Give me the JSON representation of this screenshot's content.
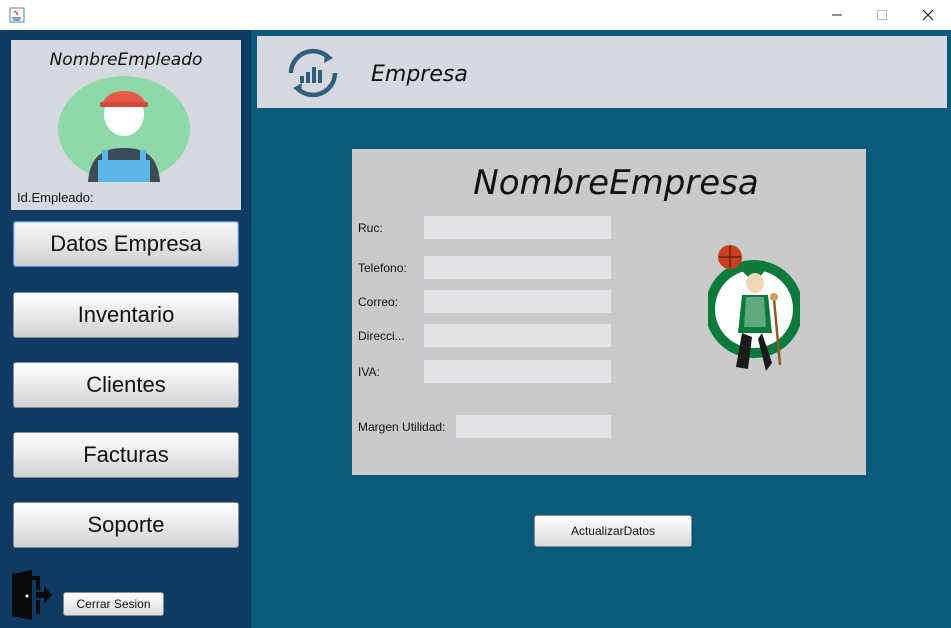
{
  "window": {
    "icon": "java-icon"
  },
  "employee": {
    "name": "NombreEmpleado",
    "id_label": "Id.Empleado:"
  },
  "nav": {
    "items": [
      {
        "label": "Datos Empresa"
      },
      {
        "label": "Inventario"
      },
      {
        "label": "Clientes"
      },
      {
        "label": "Facturas"
      },
      {
        "label": "Soporte"
      }
    ],
    "logout_label": "Cerrar Sesion"
  },
  "header": {
    "title": "Empresa"
  },
  "company": {
    "name": "NombreEmpresa",
    "fields": {
      "ruc": {
        "label": "Ruc:",
        "value": ""
      },
      "telefono": {
        "label": "Telefono:",
        "value": ""
      },
      "correo": {
        "label": "Correo:",
        "value": ""
      },
      "direccion": {
        "label": "Direcci...",
        "value": ""
      },
      "iva": {
        "label": "IVA:",
        "value": ""
      },
      "margen": {
        "label": "Margen Utilidad:",
        "value": ""
      }
    },
    "logo_icon": "boston-celtics-logo",
    "update_label": "ActualizarDatos"
  },
  "colors": {
    "sidebar": "#0f3a62",
    "main": "#0b5a7a",
    "panel": "#cacaca",
    "header": "#d6d9e0"
  }
}
